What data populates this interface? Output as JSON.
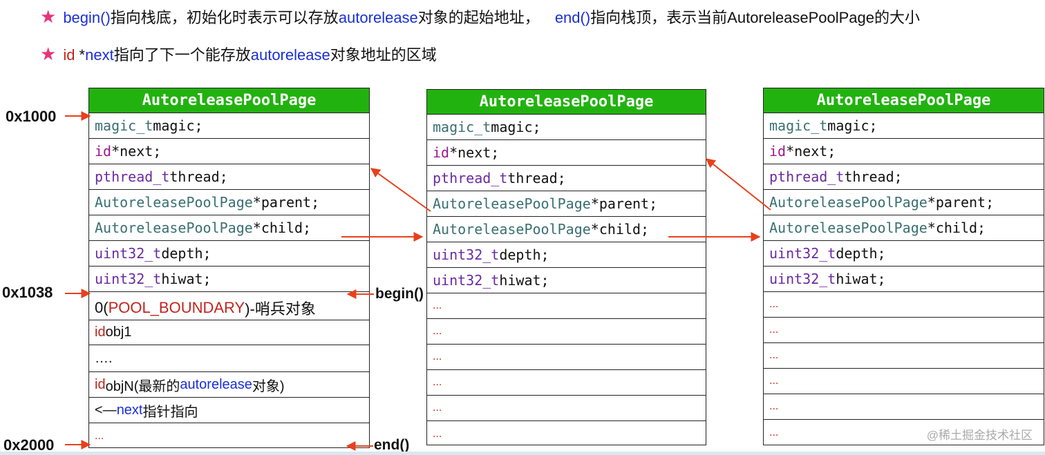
{
  "notes": {
    "line1": {
      "star": "★",
      "begin": "begin()",
      "text1": "指向栈底，初始化时表示可以存放",
      "autorelease": "autorelease",
      "text2": "对象的起始地址，",
      "end": "end()",
      "text3": "指向栈顶，表示当前AutoreleasePoolPage的大小"
    },
    "line2": {
      "star": "★",
      "id": "id",
      "star_next_prefix": " *",
      "next": "next",
      "text1": "指向了下一个能存放",
      "autorelease": "autorelease",
      "text2": "对象地址的区域"
    }
  },
  "page_title": "AutoreleasePoolPage",
  "common_rows": {
    "magic": {
      "type": "magic_t",
      "name": " magic;"
    },
    "next": {
      "type": "id",
      "name": " *next;"
    },
    "thread": {
      "type": "pthread_t",
      "name": " thread;"
    },
    "parent": {
      "type": "AutoreleasePoolPage",
      "name": " *parent;"
    },
    "child": {
      "type": "AutoreleasePoolPage",
      "name": " *child;"
    },
    "depth": {
      "type": "uint32_t",
      "name": " depth;"
    },
    "hiwat": {
      "type": "uint32_t",
      "name": " hiwat;"
    }
  },
  "page1_rows": {
    "boundary": {
      "prefix": "0(",
      "name": "POOL_BOUNDARY",
      "suffix": ")-哨兵对象"
    },
    "obj1": {
      "id": "id",
      "name": " obj1"
    },
    "dots": "….",
    "objN": {
      "id": "id",
      "name": " objN(最新的",
      "autorelease": "autorelease",
      "suffix": "对象)"
    },
    "next_ptr": {
      "prefix": "<—",
      "next": "next",
      "suffix": "指针指向"
    },
    "end_dots": "..."
  },
  "empty_slot": "...",
  "addresses": {
    "a1000": "0x1000",
    "a1038": "0x1038",
    "a2000": "0x2000"
  },
  "pointers": {
    "begin": "begin()",
    "end": "end()"
  },
  "watermark": "@稀土掘金技术社区",
  "colors": {
    "header_green": "#22b20f",
    "arrow_red": "#e8401c",
    "star_pink": "#e8337a",
    "keyword_blue": "#1a2fd6"
  }
}
